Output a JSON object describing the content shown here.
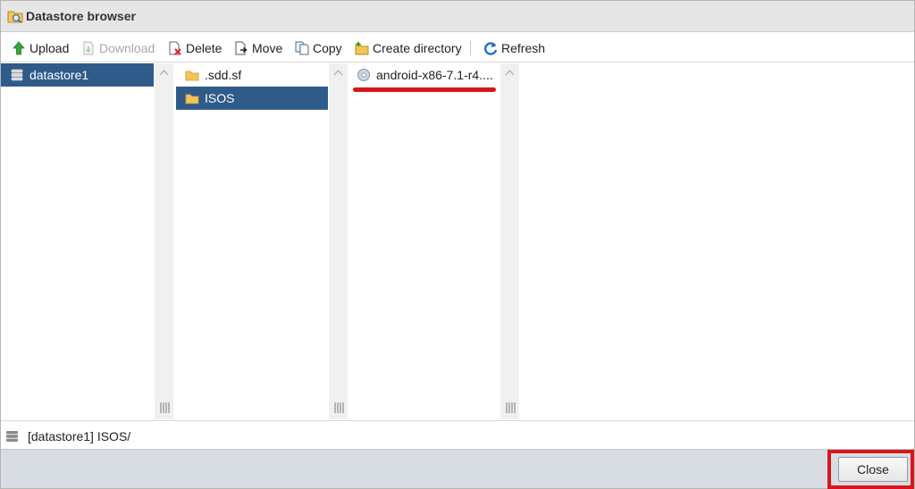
{
  "window": {
    "title": "Datastore browser"
  },
  "toolbar": {
    "upload": "Upload",
    "download": "Download",
    "delete": "Delete",
    "move": "Move",
    "copy": "Copy",
    "create_directory": "Create directory",
    "refresh": "Refresh"
  },
  "columns": {
    "datastores": [
      {
        "label": "datastore1",
        "selected": true,
        "icon": "datastore-icon"
      }
    ],
    "folders": [
      {
        "label": ".sdd.sf",
        "selected": false,
        "icon": "folder-icon"
      },
      {
        "label": "ISOS",
        "selected": true,
        "icon": "folder-icon"
      }
    ],
    "files": [
      {
        "label": "android-x86-7.1-r4....",
        "selected": false,
        "icon": "disc-image-icon"
      }
    ]
  },
  "status": {
    "path": "[datastore1] ISOS/"
  },
  "footer": {
    "close_label": "Close"
  },
  "colors": {
    "selection": "#2f5b8a",
    "highlight_red": "#d9151c",
    "footer_bg": "#d7dde3",
    "scroll_bg": "#f0f0f0"
  }
}
